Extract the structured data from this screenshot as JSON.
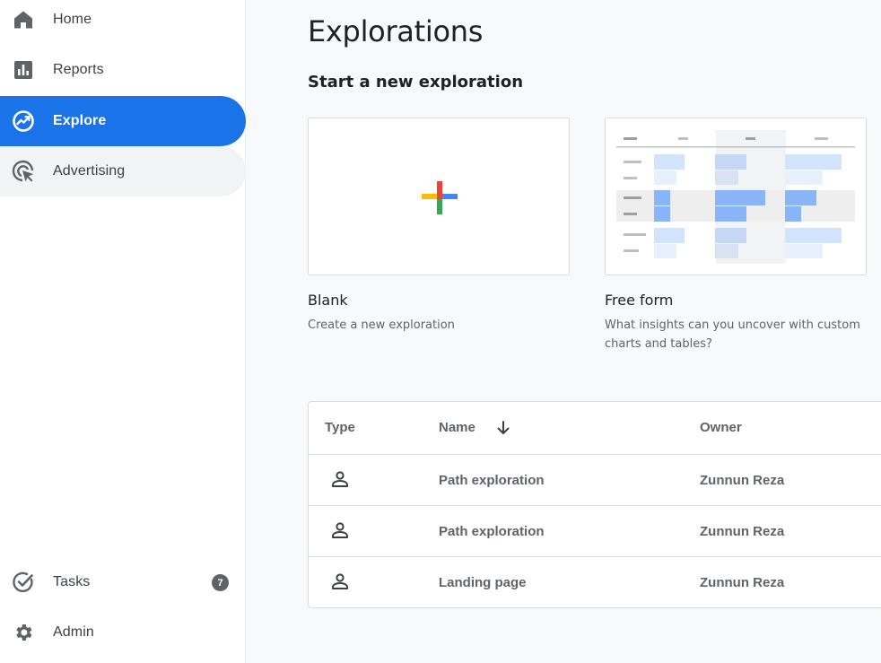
{
  "sidebar": {
    "items": [
      {
        "label": "Home",
        "icon": "home-icon"
      },
      {
        "label": "Reports",
        "icon": "reports-icon"
      },
      {
        "label": "Explore",
        "icon": "explore-icon",
        "active": true
      },
      {
        "label": "Advertising",
        "icon": "advertising-icon"
      }
    ],
    "bottom_items": [
      {
        "label": "Tasks",
        "icon": "tasks-icon",
        "badge": "7"
      },
      {
        "label": "Admin",
        "icon": "gear-icon"
      }
    ]
  },
  "main": {
    "title": "Explorations",
    "section_title": "Start a new exploration",
    "templates": [
      {
        "title": "Blank",
        "description": "Create a new exploration"
      },
      {
        "title": "Free form",
        "description": "What insights can you uncover with custom charts and tables?"
      }
    ],
    "table": {
      "headers": {
        "type": "Type",
        "name": "Name",
        "owner": "Owner"
      },
      "sort": "arrow-down-icon",
      "rows": [
        {
          "type_icon": "person-icon",
          "name": "Path exploration",
          "owner": "Zunnun Reza"
        },
        {
          "type_icon": "person-icon",
          "name": "Path exploration",
          "owner": "Zunnun Reza"
        },
        {
          "type_icon": "person-icon",
          "name": "Landing page",
          "owner": "Zunnun Reza"
        }
      ]
    }
  },
  "colors": {
    "accent": "#1a73e8",
    "text": "#202124",
    "muted": "#5f6368",
    "google_blue": "#4285f4",
    "google_red": "#ea4335",
    "google_yellow": "#fbbc04",
    "google_green": "#34a853"
  }
}
